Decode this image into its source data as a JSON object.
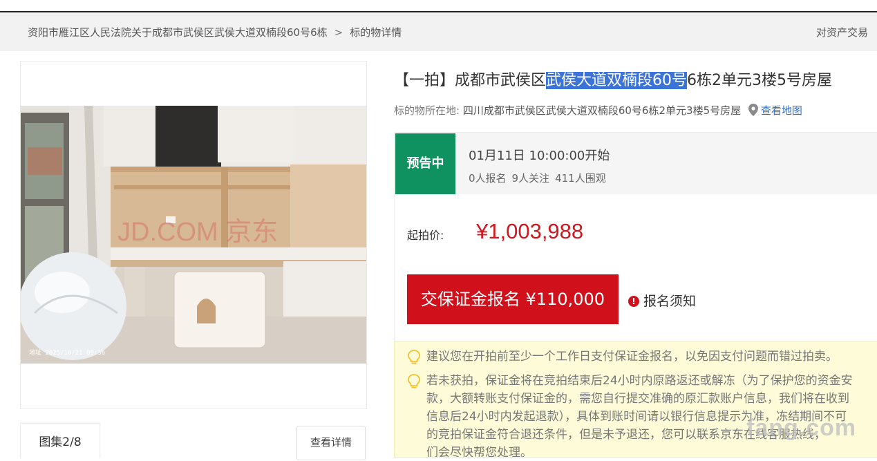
{
  "breadcrumb": {
    "case": "资阳市雁江区人民法院关于成都市武侯区武侯大道双楠段60号6栋",
    "separator": ">",
    "current": "标的物详情",
    "right_link": "对资产交易"
  },
  "gallery": {
    "photo_timestamp": "地址 2025/10/21 09:36",
    "photo_watermark": "JD.COM 京东",
    "tab_label": "图集2/8",
    "detail_button": "查看详情"
  },
  "listing": {
    "title_prefix": "【一拍】成都市武侯区",
    "title_highlight": "武侯大道双楠段60号",
    "title_suffix": "6栋2单元3楼5号房屋",
    "location_label": "标的物所在地:",
    "location_value": "四川成都市武侯区武侯大道双楠段60号6栋2单元3楼5号房屋",
    "map_link": "查看地图"
  },
  "status": {
    "badge": "预告中",
    "badge_color": "#0f9160",
    "start_time": "01月11日 10:00:00开始",
    "signups": "0人报名",
    "followers": "9人关注",
    "viewers": "411人围观"
  },
  "price": {
    "label": "起拍价:",
    "value": "¥1,003,988",
    "color": "#d2161f"
  },
  "actions": {
    "deposit_button": "交保证金报名 ¥110,000",
    "notice_link": "报名须知"
  },
  "tips": {
    "line1": "建议您在开拍前至少一个工作日支付保证金报名，以免因支付问题而错过拍卖。",
    "line2": "若未获拍，保证金将在竞拍结束后24小时内原路返还或解冻（为了保护您的资金安",
    "line3": "款，大额转账支付保证金的，需您自行提交准确的原汇款账户信息，我们将在收到",
    "line4": "信息后24小时内发起退款），具体到账时间请以银行信息提示为准，冻结期间不可",
    "line5": "的竞拍保证金符合退还条件，但是未予退还，您可以联系京东在线客服热线，",
    "line6": "们会尽快帮您处理。"
  },
  "site_watermark": "fang.com"
}
